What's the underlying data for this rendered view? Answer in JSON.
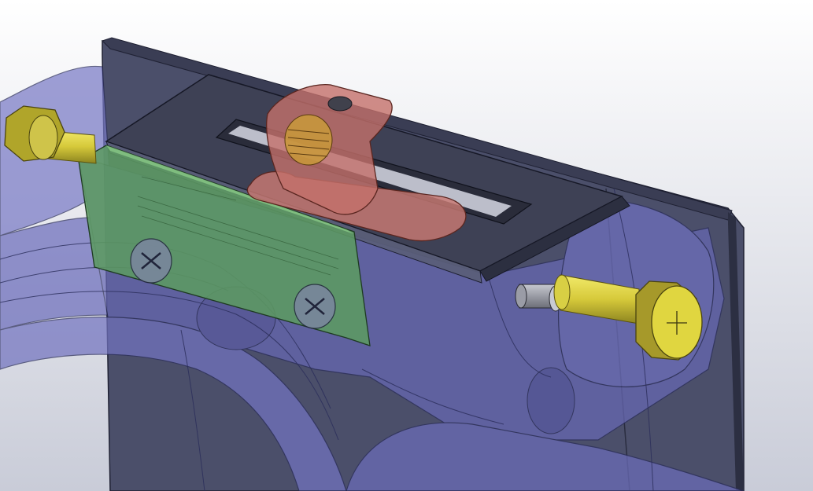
{
  "viewport": {
    "background_top": "#ffffff",
    "background_bottom": "#c9ccd8"
  },
  "colors": {
    "translucent_housing": "#6e6fbf",
    "housing_edge": "#2a2d5a",
    "base_plate": "#4a4e68",
    "base_plate_top": "#3a3d52",
    "lid": "#3c3f52",
    "pcb": "#5fa86a",
    "toggle_lever": "#c97a73",
    "bolt_thread": "#d6c93a",
    "bolt_head": "#c9c12e",
    "nut": "#a89a2a",
    "pin": "#8a8c94"
  },
  "parts": [
    {
      "name": "housing",
      "color": "translucent"
    },
    {
      "name": "base-plate"
    },
    {
      "name": "lid"
    },
    {
      "name": "pcb"
    },
    {
      "name": "toggle-lever"
    },
    {
      "name": "left-bolt"
    },
    {
      "name": "right-bolt"
    },
    {
      "name": "screw-1"
    },
    {
      "name": "screw-2"
    }
  ]
}
